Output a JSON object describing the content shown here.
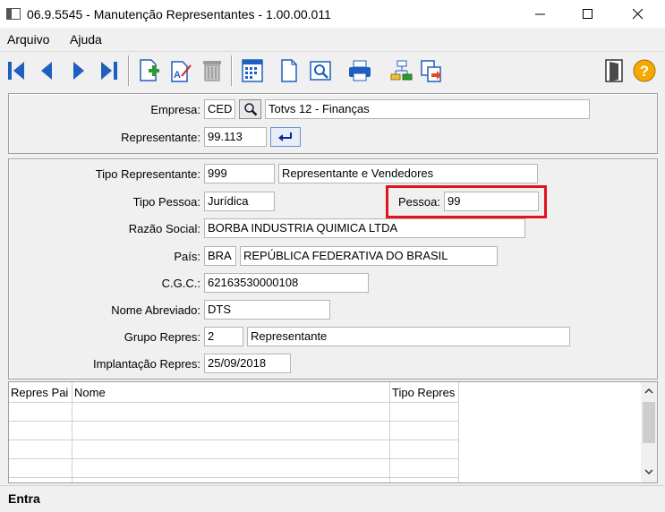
{
  "window": {
    "title": "06.9.5545 - Manutenção Representantes - 1.00.00.011"
  },
  "menu": {
    "items": [
      "Arquivo",
      "Ajuda"
    ]
  },
  "toolbar": {
    "buttons": [
      "first-icon",
      "previous-icon",
      "next-icon",
      "last-icon",
      "new-record-icon",
      "edit-record-icon",
      "delete-icon",
      "calendar-icon",
      "document-icon",
      "preview-icon",
      "print-icon",
      "tree-icon",
      "copy-icon",
      "exit-icon",
      "help-icon"
    ]
  },
  "header": {
    "empresa_label": "Empresa:",
    "empresa_code": "CED",
    "empresa_name": "Totvs 12 - Finanças",
    "representante_label": "Representante:",
    "representante_code": "99.113"
  },
  "details": {
    "tipo_representante_label": "Tipo Representante:",
    "tipo_representante_code": "999",
    "tipo_representante_desc": "Representante e Vendedores",
    "tipo_pessoa_label": "Tipo Pessoa:",
    "tipo_pessoa_value": "Jurídica",
    "pessoa_label": "Pessoa:",
    "pessoa_value": "99",
    "razao_social_label": "Razão Social:",
    "razao_social_value": "BORBA INDUSTRIA QUIMICA LTDA",
    "pais_label": "País:",
    "pais_code": "BRA",
    "pais_name": "REPÚBLICA FEDERATIVA DO BRASIL",
    "cgc_label": "C.G.C.:",
    "cgc_value": "62163530000108",
    "nome_abreviado_label": "Nome Abreviado:",
    "nome_abreviado_value": "DTS",
    "grupo_repres_label": "Grupo Repres:",
    "grupo_repres_code": "2",
    "grupo_repres_desc": "Representante",
    "implantacao_label": "Implantação Repres:",
    "implantacao_value": "25/09/2018"
  },
  "grid": {
    "columns": [
      "Repres Pai",
      "Nome",
      "Tipo Repres"
    ]
  },
  "status": {
    "text": "Entra"
  },
  "colors": {
    "highlight": "#e0141c",
    "toolbar_blue": "#1f5fbf"
  }
}
